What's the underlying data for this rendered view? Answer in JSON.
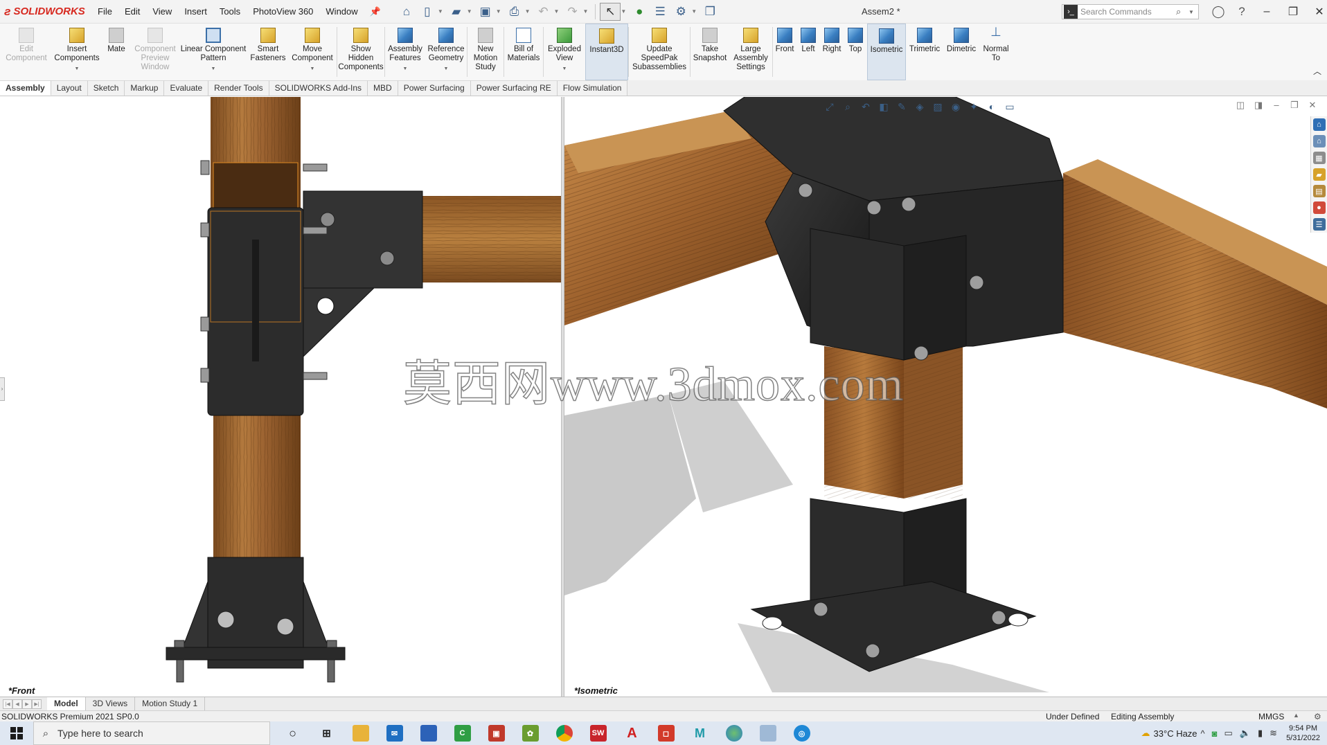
{
  "app": {
    "brand": "SOLIDWORKS",
    "document_title": "Assem2 *"
  },
  "menu": [
    "File",
    "Edit",
    "View",
    "Insert",
    "Tools",
    "PhotoView 360",
    "Window"
  ],
  "search": {
    "placeholder": "Search Commands"
  },
  "ribbon": {
    "edit_component": "Edit Component",
    "insert_components": "Insert Components",
    "mate": "Mate",
    "component_preview": "Component Preview Window",
    "linear_pattern": "Linear Component Pattern",
    "smart_fasteners": "Smart Fasteners",
    "move_component": "Move Component",
    "show_hidden": "Show Hidden Components",
    "assembly_features": "Assembly Features",
    "reference_geometry": "Reference Geometry",
    "new_motion_study": "New Motion Study",
    "bill_of_materials": "Bill of Materials",
    "exploded_view": "Exploded View",
    "instant3d": "Instant3D",
    "update_speedpak": "Update SpeedPak Subassemblies",
    "take_snapshot": "Take Snapshot",
    "large_assembly": "Large Assembly Settings",
    "front": "Front",
    "left": "Left",
    "right": "Right",
    "top": "Top",
    "isometric": "Isometric",
    "trimetric": "Trimetric",
    "dimetric": "Dimetric",
    "normal_to": "Normal To"
  },
  "cm_tabs": [
    "Assembly",
    "Layout",
    "Sketch",
    "Markup",
    "Evaluate",
    "Render Tools",
    "SOLIDWORKS Add-Ins",
    "MBD",
    "Power Surfacing",
    "Power Surfacing RE",
    "Flow Simulation"
  ],
  "viewports": {
    "front_label": "*Front",
    "iso_label": "*Isometric"
  },
  "watermark": "莫西网www.3dmox.com",
  "bottom_tabs": [
    "Model",
    "3D Views",
    "Motion Study 1"
  ],
  "status": {
    "product": "SOLIDWORKS Premium 2021 SP0.0",
    "definition": "Under Defined",
    "mode": "Editing Assembly",
    "units": "MMGS"
  },
  "taskbar": {
    "search_placeholder": "Type here to search",
    "weather": "33°C  Haze",
    "time": "9:54 PM",
    "date": "5/31/2022"
  },
  "colors": {
    "accent": "#3b6fa8",
    "steel": "#2b2b2b",
    "wood": "#a8692f",
    "brand": "#d7281f"
  }
}
